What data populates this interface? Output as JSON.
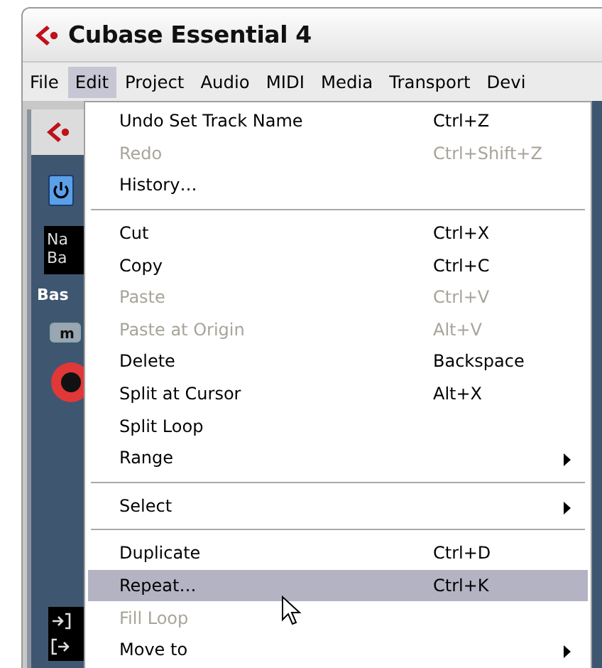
{
  "window": {
    "title": "Cubase Essential 4"
  },
  "menu_bar": [
    {
      "label": "File",
      "selected": false
    },
    {
      "label": "Edit",
      "selected": true
    },
    {
      "label": "Project",
      "selected": false
    },
    {
      "label": "Audio",
      "selected": false
    },
    {
      "label": "MIDI",
      "selected": false
    },
    {
      "label": "Media",
      "selected": false
    },
    {
      "label": "Transport",
      "selected": false
    },
    {
      "label": "Devi",
      "selected": false
    }
  ],
  "track_panel": {
    "name_field": [
      "Na",
      "Ba"
    ],
    "track_label": "Bas",
    "mute_button": "m"
  },
  "edit_menu": [
    {
      "kind": "command",
      "label": "Undo Set Track Name",
      "shortcut": "Ctrl+Z",
      "disabled": false,
      "selected": false
    },
    {
      "kind": "command",
      "label": "Redo",
      "shortcut": "Ctrl+Shift+Z",
      "disabled": true,
      "selected": false
    },
    {
      "kind": "command",
      "label": "History…",
      "disabled": false,
      "selected": false
    },
    {
      "kind": "separator"
    },
    {
      "kind": "command",
      "label": "Cut",
      "shortcut": "Ctrl+X",
      "disabled": false,
      "selected": false
    },
    {
      "kind": "command",
      "label": "Copy",
      "shortcut": "Ctrl+C",
      "disabled": false,
      "selected": false
    },
    {
      "kind": "command",
      "label": "Paste",
      "shortcut": "Ctrl+V",
      "disabled": true,
      "selected": false
    },
    {
      "kind": "command",
      "label": "Paste at Origin",
      "shortcut": "Alt+V",
      "disabled": true,
      "selected": false
    },
    {
      "kind": "command",
      "label": "Delete",
      "shortcut": "Backspace",
      "disabled": false,
      "selected": false
    },
    {
      "kind": "command",
      "label": "Split at Cursor",
      "shortcut": "Alt+X",
      "disabled": false,
      "selected": false
    },
    {
      "kind": "command",
      "label": "Split Loop",
      "disabled": false,
      "selected": false
    },
    {
      "kind": "submenu",
      "label": "Range",
      "disabled": false,
      "selected": false
    },
    {
      "kind": "separator"
    },
    {
      "kind": "submenu",
      "label": "Select",
      "disabled": false,
      "selected": false
    },
    {
      "kind": "separator"
    },
    {
      "kind": "command",
      "label": "Duplicate",
      "shortcut": "Ctrl+D",
      "disabled": false,
      "selected": false
    },
    {
      "kind": "command",
      "label": "Repeat…",
      "shortcut": "Ctrl+K",
      "disabled": false,
      "selected": true
    },
    {
      "kind": "command",
      "label": "Fill Loop",
      "disabled": true,
      "selected": false
    },
    {
      "kind": "submenu",
      "label": "Move to",
      "disabled": false,
      "selected": false
    }
  ]
}
